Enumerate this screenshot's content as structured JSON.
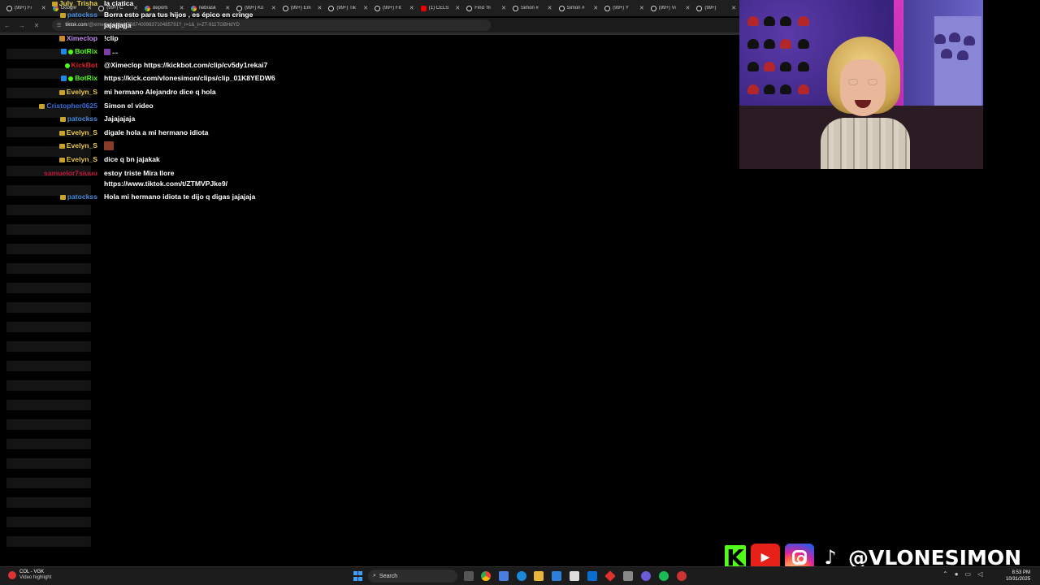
{
  "browser": {
    "tabs": [
      {
        "label": "(99+) Fi",
        "icon": "tiktok-icon"
      },
      {
        "label": "Google",
        "icon": "google-icon"
      },
      {
        "label": "(99+) C",
        "icon": "tiktok-icon"
      },
      {
        "label": "deporti",
        "icon": "google-icon"
      },
      {
        "label": "nebrask",
        "icon": "google-icon"
      },
      {
        "label": "(99+) Ko",
        "icon": "tiktok-icon"
      },
      {
        "label": "(99+) Em",
        "icon": "tiktok-icon"
      },
      {
        "label": "(99+) Tik",
        "icon": "tiktok-icon"
      },
      {
        "label": "(99+) Fit",
        "icon": "tiktok-icon"
      },
      {
        "label": "(1) CELS",
        "icon": "youtube-icon"
      },
      {
        "label": "Find 'm",
        "icon": "tiktok-icon"
      },
      {
        "label": "Simon #",
        "icon": "tiktok-icon"
      },
      {
        "label": "Simon #",
        "icon": "tiktok-icon"
      },
      {
        "label": "(99+) Y",
        "icon": "tiktok-icon"
      },
      {
        "label": "(99+) Vi",
        "icon": "tiktok-icon"
      },
      {
        "label": "(99+)",
        "icon": "tiktok-icon"
      }
    ],
    "url_domain": "tiktok.com",
    "url_rest": "/@ximeclop/video/7567400983710485791?_r=1&_t=ZT-911TGBHdYD"
  },
  "chat": [
    {
      "user": "July_Trisha",
      "color": "#e8d44d",
      "badges": [
        "crown"
      ],
      "text": "la ciatica"
    },
    {
      "user": "patockss",
      "color": "#4a90e2",
      "badges": [
        "crown"
      ],
      "text": "Borra esto para tus hijos , es épico en cringe"
    },
    {
      "user": "",
      "color": "#ffffff",
      "badges": [],
      "text": "jajajjajja"
    },
    {
      "user": "Ximeclop",
      "color": "#c58cf0",
      "badges": [
        "sub"
      ],
      "text": "!clip"
    },
    {
      "user": "BotRix",
      "color": "#53fc18",
      "badges": [
        "bot",
        "check"
      ],
      "text": "..."
    },
    {
      "user": "KickBot",
      "color": "#e0202a",
      "badges": [
        "check"
      ],
      "text": "@Ximeclop https://kickbot.com/clip/cv5dy1rekai7"
    },
    {
      "user": "BotRix",
      "color": "#53fc18",
      "badges": [
        "bot",
        "check"
      ],
      "text": "https://kick.com/vlonesimon/clips/clip_01K8YEDW6"
    },
    {
      "user": "Evelyn_S",
      "color": "#e8c84a",
      "badges": [
        "crown"
      ],
      "text": "mi hermano Alejandro dice q hola"
    },
    {
      "user": "Cristopher0625",
      "color": "#3b6fd8",
      "badges": [
        "crown"
      ],
      "text": "Simon el video"
    },
    {
      "user": "patockss",
      "color": "#4a90e2",
      "badges": [
        "crown"
      ],
      "text": "Jajajajaja"
    },
    {
      "user": "Evelyn_S",
      "color": "#e8c84a",
      "badges": [
        "crown"
      ],
      "text": "digale hola a mi hermano idiota"
    },
    {
      "user": "Evelyn_S",
      "color": "#e8c84a",
      "badges": [
        "crown"
      ],
      "text": ""
    },
    {
      "user": "Evelyn_S",
      "color": "#e8c84a",
      "badges": [
        "crown"
      ],
      "text": "dice q bn jajakak"
    },
    {
      "user": "samuelor7siuuu",
      "color": "#c2183a",
      "badges": [],
      "text": "estoy triste Mira llore",
      "text2": "https://www.tiktok.com/t/ZTMVPJke9/"
    },
    {
      "user": "patockss",
      "color": "#4a90e2",
      "badges": [
        "crown"
      ],
      "text": "Hola mi hermano idiota te dijo q digas jajajaja"
    }
  ],
  "social": {
    "handle": "@VLONESIMON",
    "icons": [
      "kick-icon",
      "youtube-icon",
      "instagram-icon",
      "tiktok-icon"
    ],
    "kick_glyph": "K",
    "yt_glyph": "▶",
    "tt_glyph": "♪"
  },
  "taskbar": {
    "weather_line1": "COL - VGK",
    "weather_line2": "Video highlight",
    "search_label": "Search",
    "time": "8:53 PM",
    "date": "10/31/2025"
  }
}
